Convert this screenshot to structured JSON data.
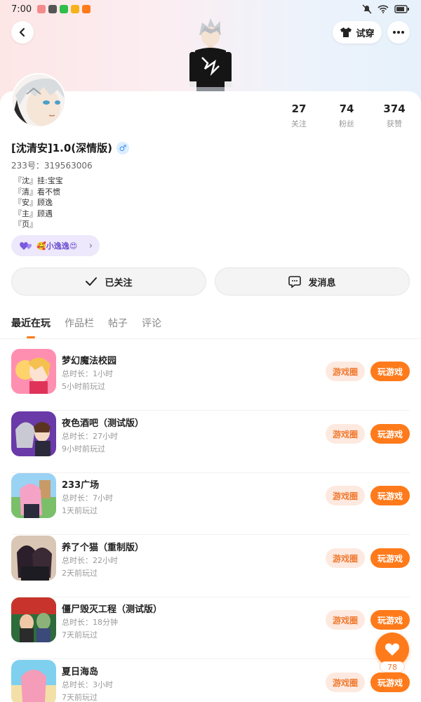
{
  "status_bar": {
    "time": "7:00"
  },
  "header": {
    "try_on_label": "试穿"
  },
  "profile": {
    "name": "[沈清安]1.0(深情版)",
    "gender_symbol": "♂",
    "uid": "233号：319563006",
    "bio": [
      "『沈』挂:宝宝",
      "『清』看不惯",
      "『安』顾逸",
      "『主』顾遇",
      "『页』"
    ],
    "tag": "🥰小逸逸😍",
    "stats": [
      {
        "value": "27",
        "label": "关注"
      },
      {
        "value": "74",
        "label": "粉丝"
      },
      {
        "value": "374",
        "label": "获赞"
      }
    ]
  },
  "actions": {
    "follow_label": "已关注",
    "message_label": "发消息"
  },
  "tabs": [
    {
      "label": "最近在玩",
      "active": true
    },
    {
      "label": "作品栏",
      "active": false
    },
    {
      "label": "帖子",
      "active": false
    },
    {
      "label": "评论",
      "active": false
    }
  ],
  "game_circle_label": "游戏圈",
  "play_label": "玩游戏",
  "games": [
    {
      "title": "梦幻魔法校园",
      "duration": "总时长：1小时",
      "last_played": "5小时前玩过"
    },
    {
      "title": "夜色酒吧（测试版）",
      "duration": "总时长：27小时",
      "last_played": "9小时前玩过"
    },
    {
      "title": "233广场",
      "duration": "总时长：7小时",
      "last_played": "1天前玩过"
    },
    {
      "title": "养了个猫（重制版）",
      "duration": "总时长：22小时",
      "last_played": "2天前玩过"
    },
    {
      "title": "僵尸毁灭工程（测试版）",
      "duration": "总时长：18分钟",
      "last_played": "7天前玩过"
    },
    {
      "title": "夏日海岛",
      "duration": "总时长：3小时",
      "last_played": "7天前玩过"
    }
  ],
  "fab": {
    "count": "78"
  },
  "colors": {
    "accent": "#ff7a1a",
    "accent_light": "#fde9df",
    "tag_bg": "#ede8fb"
  }
}
